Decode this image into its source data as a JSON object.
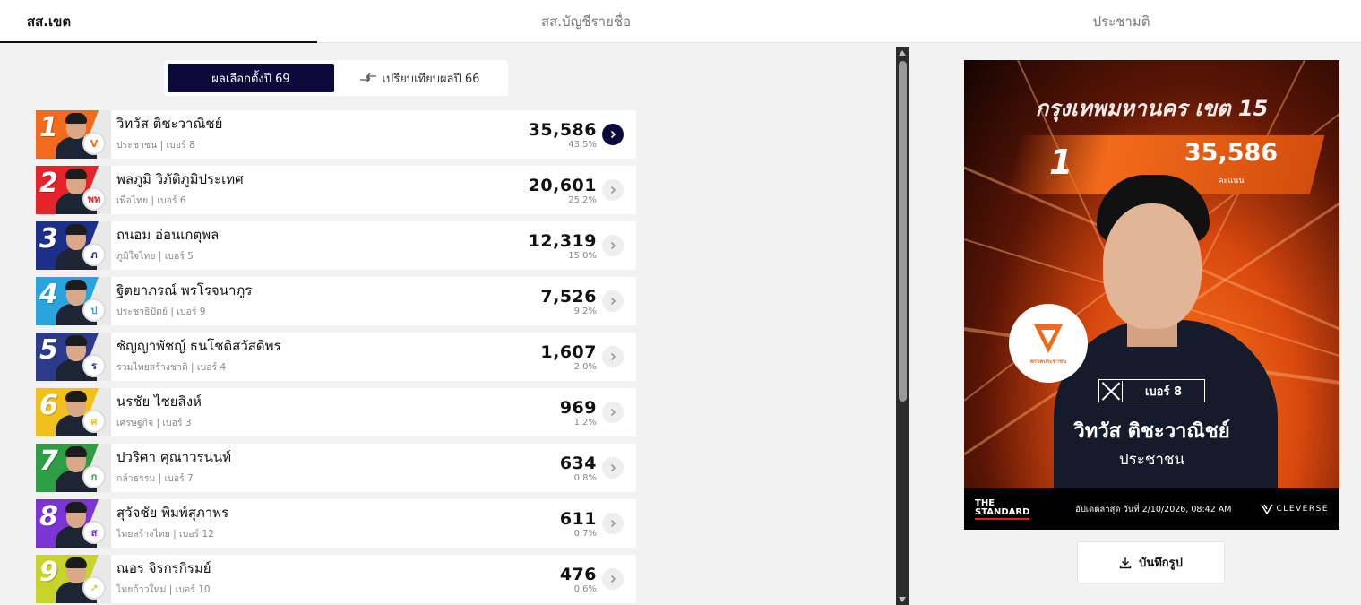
{
  "tabs": [
    {
      "label": "สส.เขต"
    },
    {
      "label": "สส.บัญชีรายชื่อ"
    },
    {
      "label": "ประชามติ"
    }
  ],
  "toggle": {
    "active_label": "ผลเลือกตั้งปี 69",
    "compare_label": "เปรียบเทียบผลปี 66"
  },
  "candidates": [
    {
      "rank": "1",
      "name": "วิทวัส ติชะวาณิชย์",
      "party_line": "ประชาชน | เบอร์ 8",
      "votes": "35,586",
      "pct": "43.5%",
      "color": "#f26a1b",
      "logo": "V"
    },
    {
      "rank": "2",
      "name": "พลภูมิ วิภัติภูมิประเทศ",
      "party_line": "เพื่อไทย | เบอร์ 6",
      "votes": "20,601",
      "pct": "25.2%",
      "color": "#e4232b",
      "logo": "พท"
    },
    {
      "rank": "3",
      "name": "ถนอม อ่อนเกตุพล",
      "party_line": "ภูมิใจไทย | เบอร์ 5",
      "votes": "12,319",
      "pct": "15.0%",
      "color": "#1c2f8a",
      "logo": "ภ"
    },
    {
      "rank": "4",
      "name": "ฐิตยาภรณ์ พรโรจนาภูร",
      "party_line": "ประชาธิปัตย์ | เบอร์ 9",
      "votes": "7,526",
      "pct": "9.2%",
      "color": "#29a4dd",
      "logo": "ป"
    },
    {
      "rank": "5",
      "name": "ชัญญาพัชญ์ ธนโชติสวัสดิพร",
      "party_line": "รวมไทยสร้างชาติ | เบอร์ 4",
      "votes": "1,607",
      "pct": "2.0%",
      "color": "#2b3a8a",
      "logo": "ร"
    },
    {
      "rank": "6",
      "name": "นรชัย ไชยสิงห์",
      "party_line": "เศรษฐกิจ | เบอร์ 3",
      "votes": "969",
      "pct": "1.2%",
      "color": "#f2c01b",
      "logo": "ศ"
    },
    {
      "rank": "7",
      "name": "ปวริศา คุณาวรนนท์",
      "party_line": "กล้าธรรม | เบอร์ 7",
      "votes": "634",
      "pct": "0.8%",
      "color": "#2e9e44",
      "logo": "ก"
    },
    {
      "rank": "8",
      "name": "สุวัจชัย พิมพ์สุภาพร",
      "party_line": "ไทยสร้างไทย | เบอร์ 12",
      "votes": "611",
      "pct": "0.7%",
      "color": "#7b35d6",
      "logo": "ส"
    },
    {
      "rank": "9",
      "name": "ณอร จิรกรกิรมย์",
      "party_line": "ไทยก้าวใหม่ | เบอร์ 10",
      "votes": "476",
      "pct": "0.6%",
      "color": "#c8d42a",
      "logo": "↗"
    }
  ],
  "poster": {
    "city": "กรุงเทพมหานคร เขต 15",
    "rank": "1",
    "votes": "35,586",
    "votes_unit": "คะแนน",
    "party_logo_text": "พรรคประชาชน",
    "ballot_number": "เบอร์ 8",
    "candidate_name": "วิทวัส ติชะวาณิชย์",
    "party": "ประชาชน",
    "brand_top": "THE",
    "brand_bottom": "STANDARD",
    "updated": "อัปเดตล่าสุด วันที่ 2/10/2026, 08:42 AM",
    "sponsor": "CLEVERSE"
  },
  "save_label": "บันทึกรูป",
  "colors": {
    "navy": "#0b0b3b",
    "orange": "#f26a1b"
  }
}
